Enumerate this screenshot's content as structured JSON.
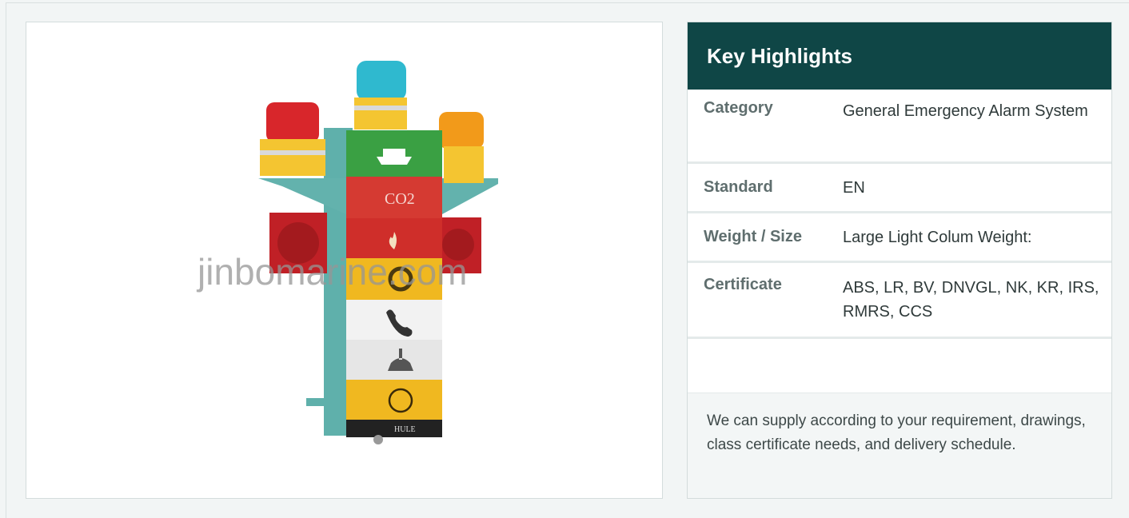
{
  "product_image": {
    "alt": "General emergency alarm light column with rotating beacons and sirens",
    "watermark": "jinbomarine.com",
    "brand_plate": "HULE",
    "co2_label": "CO2"
  },
  "highlights": {
    "title": "Key Highlights",
    "rows": [
      {
        "key": "Category",
        "value": "General Emergency Alarm System"
      },
      {
        "key": "Standard",
        "value": "EN"
      },
      {
        "key": "Weight / Size",
        "value": "Large Light Colum Weight:"
      },
      {
        "key": "Certificate",
        "value": "ABS, LR, BV, DNVGL, NK, KR, IRS, RMRS, CCS"
      }
    ],
    "note": "We can supply according to your requirement, drawings, class certificate needs, and delivery schedule."
  },
  "colors": {
    "header_bg": "#0f4646",
    "beacon_red": "#d8262b",
    "beacon_blue": "#2fb9cf",
    "beacon_amber": "#f29a1a",
    "panel_green": "#3aa043",
    "panel_red": "#d53a32",
    "panel_yellow": "#f0b820",
    "bracket_teal": "#63b2ad"
  },
  "icons": [
    "ship-icon",
    "co2-icon",
    "fire-icon",
    "gear-icon",
    "phone-icon",
    "bell-icon",
    "person-icon"
  ]
}
